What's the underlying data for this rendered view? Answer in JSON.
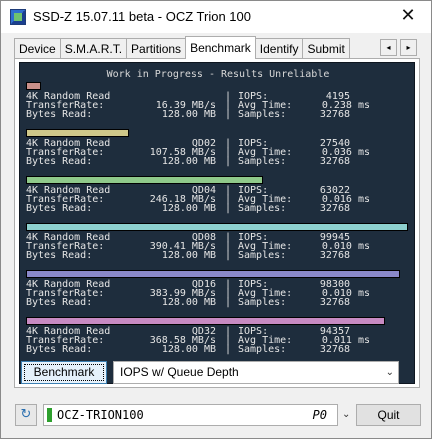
{
  "window": {
    "title": "SSD-Z 15.07.11 beta - OCZ Trion 100",
    "close_glyph": "✕"
  },
  "tabs": [
    {
      "label": "Device",
      "active": false
    },
    {
      "label": "S.M.A.R.T.",
      "active": false
    },
    {
      "label": "Partitions",
      "active": false
    },
    {
      "label": "Benchmark",
      "active": true
    },
    {
      "label": "Identify",
      "active": false
    },
    {
      "label": "Submit",
      "active": false
    }
  ],
  "tab_scroll": {
    "left": "◂",
    "right": "▸"
  },
  "benchmark": {
    "header": "Work in Progress - Results Unreliable",
    "labels": {
      "test": "4K Random Read",
      "transfer": "TransferRate:",
      "bytes": "Bytes Read:",
      "iops": "IOPS:",
      "avg": "Avg Time:",
      "samples": "Samples:"
    },
    "runs": [
      {
        "qd": "",
        "transfer": "16.39 MB/s",
        "bytes": "128.00 MB",
        "iops": "4195",
        "avg": "0.238 ms",
        "samples": "32768",
        "bar_color": "#c9908a",
        "bar_fill": 0.04
      },
      {
        "qd": "QD02",
        "transfer": "107.58 MB/s",
        "bytes": "128.00 MB",
        "iops": "27540",
        "avg": "0.036 ms",
        "samples": "32768",
        "bar_color": "#cfc88a",
        "bar_fill": 0.27
      },
      {
        "qd": "QD04",
        "transfer": "246.18 MB/s",
        "bytes": "128.00 MB",
        "iops": "63022",
        "avg": "0.016 ms",
        "samples": "32768",
        "bar_color": "#8fc98a",
        "bar_fill": 0.62
      },
      {
        "qd": "QD08",
        "transfer": "390.41 MB/s",
        "bytes": "128.00 MB",
        "iops": "99945",
        "avg": "0.010 ms",
        "samples": "32768",
        "bar_color": "#8ccfce",
        "bar_fill": 1.0
      },
      {
        "qd": "QD16",
        "transfer": "383.99 MB/s",
        "bytes": "128.00 MB",
        "iops": "98300",
        "avg": "0.010 ms",
        "samples": "32768",
        "bar_color": "#8a88c9",
        "bar_fill": 0.98
      },
      {
        "qd": "QD32",
        "transfer": "368.58 MB/s",
        "bytes": "128.00 MB",
        "iops": "94357",
        "avg": "0.011 ms",
        "samples": "32768",
        "bar_color": "#c78ac2",
        "bar_fill": 0.94
      }
    ],
    "button_label": "Benchmark",
    "mode_select": "IOPS w/ Queue Depth",
    "select_chevron": "⌄"
  },
  "footer": {
    "refresh_glyph": "↻",
    "drive_name": "OCZ-TRION100",
    "drive_port": "P0",
    "drive_chevron": "⌄",
    "quit_label": "Quit"
  }
}
